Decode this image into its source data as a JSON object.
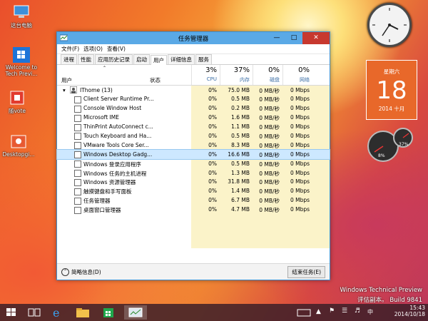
{
  "desktop": {
    "icons": [
      {
        "label": "这台电脑"
      },
      {
        "label": "Welcome to Tech Previ..."
      },
      {
        "label": "随vote"
      },
      {
        "label": "Desktopgi..."
      }
    ],
    "watermark_line1": "Windows Technical Preview",
    "watermark_line2": "评估副本。 Build 9841"
  },
  "window": {
    "title": "任务管理器",
    "menu": [
      "文件(F)",
      "选项(O)",
      "查看(V)"
    ],
    "tabs": [
      "进程",
      "性能",
      "应用历史记录",
      "启动",
      "用户",
      "详细信息",
      "服务"
    ],
    "active_tab_index": 4,
    "columns": {
      "user": "用户",
      "status": "状态",
      "cpu": {
        "pct": "3%",
        "label": "CPU"
      },
      "mem": {
        "pct": "37%",
        "label": "内存"
      },
      "disk": {
        "pct": "0%",
        "label": "磁盘"
      },
      "net": {
        "pct": "0%",
        "label": "网络"
      }
    },
    "group": {
      "name": "IThome (13)",
      "cpu": "0%",
      "mem": "75.0 MB",
      "disk": "0 MB/秒",
      "net": "0 Mbps"
    },
    "rows": [
      {
        "name": "Client Server Runtime Pr...",
        "cpu": "0%",
        "mem": "0.5 MB",
        "disk": "0 MB/秒",
        "net": "0 Mbps"
      },
      {
        "name": "Console Window Host",
        "cpu": "0%",
        "mem": "0.2 MB",
        "disk": "0 MB/秒",
        "net": "0 Mbps"
      },
      {
        "name": "Microsoft IME",
        "cpu": "0%",
        "mem": "1.6 MB",
        "disk": "0 MB/秒",
        "net": "0 Mbps"
      },
      {
        "name": "ThinPrint AutoConnect c...",
        "cpu": "0%",
        "mem": "1.1 MB",
        "disk": "0 MB/秒",
        "net": "0 Mbps"
      },
      {
        "name": "Touch Keyboard and Ha...",
        "cpu": "0%",
        "mem": "0.5 MB",
        "disk": "0 MB/秒",
        "net": "0 Mbps"
      },
      {
        "name": "VMware Tools Core Ser...",
        "cpu": "0%",
        "mem": "8.3 MB",
        "disk": "0 MB/秒",
        "net": "0 Mbps"
      },
      {
        "name": "Windows Desktop Gadg...",
        "cpu": "0%",
        "mem": "16.6 MB",
        "disk": "0 MB/秒",
        "net": "0 Mbps"
      },
      {
        "name": "Windows 登录应用程序",
        "cpu": "0%",
        "mem": "0.5 MB",
        "disk": "0 MB/秒",
        "net": "0 Mbps"
      },
      {
        "name": "Windows 任务的主机进程",
        "cpu": "0%",
        "mem": "1.3 MB",
        "disk": "0 MB/秒",
        "net": "0 Mbps"
      },
      {
        "name": "Windows 资源管理器",
        "cpu": "0%",
        "mem": "31.8 MB",
        "disk": "0 MB/秒",
        "net": "0 Mbps"
      },
      {
        "name": "触摸键盘和手写面板",
        "cpu": "0%",
        "mem": "1.4 MB",
        "disk": "0 MB/秒",
        "net": "0 Mbps"
      },
      {
        "name": "任务管理器",
        "cpu": "0%",
        "mem": "6.7 MB",
        "disk": "0 MB/秒",
        "net": "0 Mbps"
      },
      {
        "name": "桌面窗口管理器",
        "cpu": "0%",
        "mem": "4.7 MB",
        "disk": "0 MB/秒",
        "net": "0 Mbps"
      }
    ],
    "selected_row_index": 6,
    "fewer_details": "简略信息(D)",
    "end_task": "结束任务(E)"
  },
  "gadgets": {
    "calendar": {
      "weekday": "星期六",
      "day": "18",
      "month": "2014 十月"
    },
    "meters": {
      "left": "8%",
      "right": "37%"
    }
  },
  "taskbar": {
    "time": "15:43",
    "date": "2014/10/18"
  },
  "colors": {
    "title_bar": "#5aa9e6",
    "selection": "#cde8ff",
    "heat": "#fbf3c9",
    "calendar": "#e8682a"
  }
}
